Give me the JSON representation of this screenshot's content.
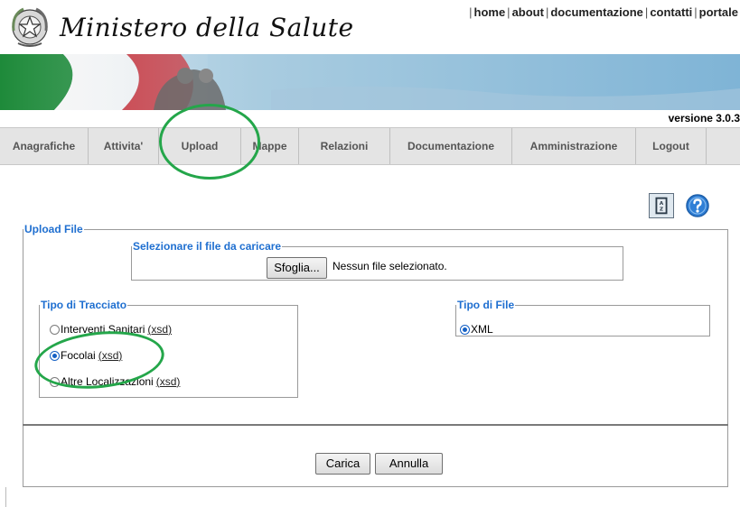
{
  "header": {
    "logo_text": "Ministero della Salute",
    "top_links": [
      "home",
      "about",
      "documentazione",
      "contatti",
      "portale"
    ]
  },
  "version": "versione 3.0.3",
  "navbar": {
    "items": [
      {
        "label": "Anagrafiche"
      },
      {
        "label": "Attivita'"
      },
      {
        "label": "Upload"
      },
      {
        "label": "Mappe"
      },
      {
        "label": "Relazioni"
      },
      {
        "label": "Documentazione"
      },
      {
        "label": "Amministrazione"
      },
      {
        "label": "Logout"
      }
    ],
    "highlighted": "Upload"
  },
  "help": {
    "index_icon": "az-index-icon",
    "help_icon": "question-icon"
  },
  "upload": {
    "legend": "Upload File",
    "file_legend": "Selezionare il file da caricare",
    "browse_label": "Sfoglia...",
    "file_status": "Nessun file selezionato.",
    "tracciato": {
      "legend": "Tipo di Tracciato",
      "options": [
        {
          "label": "Interventi Sanitari",
          "link": "xsd",
          "selected": false
        },
        {
          "label": "Focolai",
          "link": "xsd",
          "selected": true
        },
        {
          "label": "Altre Localizzazioni",
          "link": "xsd",
          "selected": false
        }
      ]
    },
    "tipo_file": {
      "legend": "Tipo di File",
      "options": [
        {
          "label": "XML",
          "selected": true
        }
      ]
    },
    "submit_label": "Carica",
    "cancel_label": "Annulla"
  },
  "colors": {
    "annotation": "#24a64a",
    "legend": "#1f6fd0",
    "navbar_bg": "#e4e4e4"
  }
}
